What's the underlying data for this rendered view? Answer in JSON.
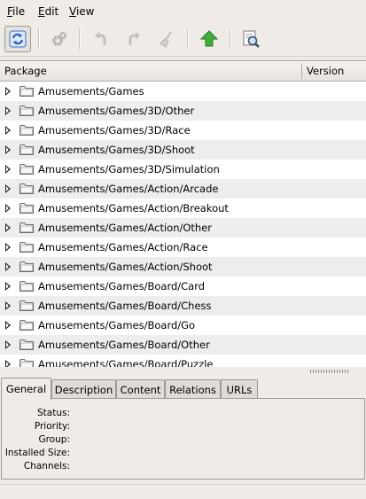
{
  "menubar": {
    "items": [
      "File",
      "Edit",
      "View"
    ],
    "mnemonics": [
      "F",
      "E",
      "V"
    ],
    "rest": [
      "ile",
      "dit",
      "iew"
    ]
  },
  "toolbar": {
    "buttons": [
      {
        "name": "refresh-icon",
        "enabled": true,
        "pressed": true
      },
      {
        "name": "gears-icon",
        "enabled": false
      },
      {
        "name": "undo-icon",
        "enabled": false
      },
      {
        "name": "redo-icon",
        "enabled": false
      },
      {
        "name": "broom-icon",
        "enabled": false
      },
      {
        "name": "apply-up-arrow-icon",
        "enabled": true
      },
      {
        "name": "search-magnifier-icon",
        "enabled": true
      }
    ],
    "colors": {
      "apply": "#2e9a2e",
      "refresh": "#2a64c4"
    }
  },
  "tree": {
    "columns": [
      "Package",
      "Version"
    ],
    "rows": [
      "Amusements/Games",
      "Amusements/Games/3D/Other",
      "Amusements/Games/3D/Race",
      "Amusements/Games/3D/Shoot",
      "Amusements/Games/3D/Simulation",
      "Amusements/Games/Action/Arcade",
      "Amusements/Games/Action/Breakout",
      "Amusements/Games/Action/Other",
      "Amusements/Games/Action/Race",
      "Amusements/Games/Action/Shoot",
      "Amusements/Games/Board/Card",
      "Amusements/Games/Board/Chess",
      "Amusements/Games/Board/Go",
      "Amusements/Games/Board/Other",
      "Amusements/Games/Board/Puzzle"
    ]
  },
  "tabs": {
    "items": [
      "General",
      "Description",
      "Content",
      "Relations",
      "URLs"
    ],
    "active": "General"
  },
  "general": {
    "labels": [
      "Status:",
      "Priority:",
      "Group:",
      "Installed Size:",
      "Channels:"
    ]
  }
}
